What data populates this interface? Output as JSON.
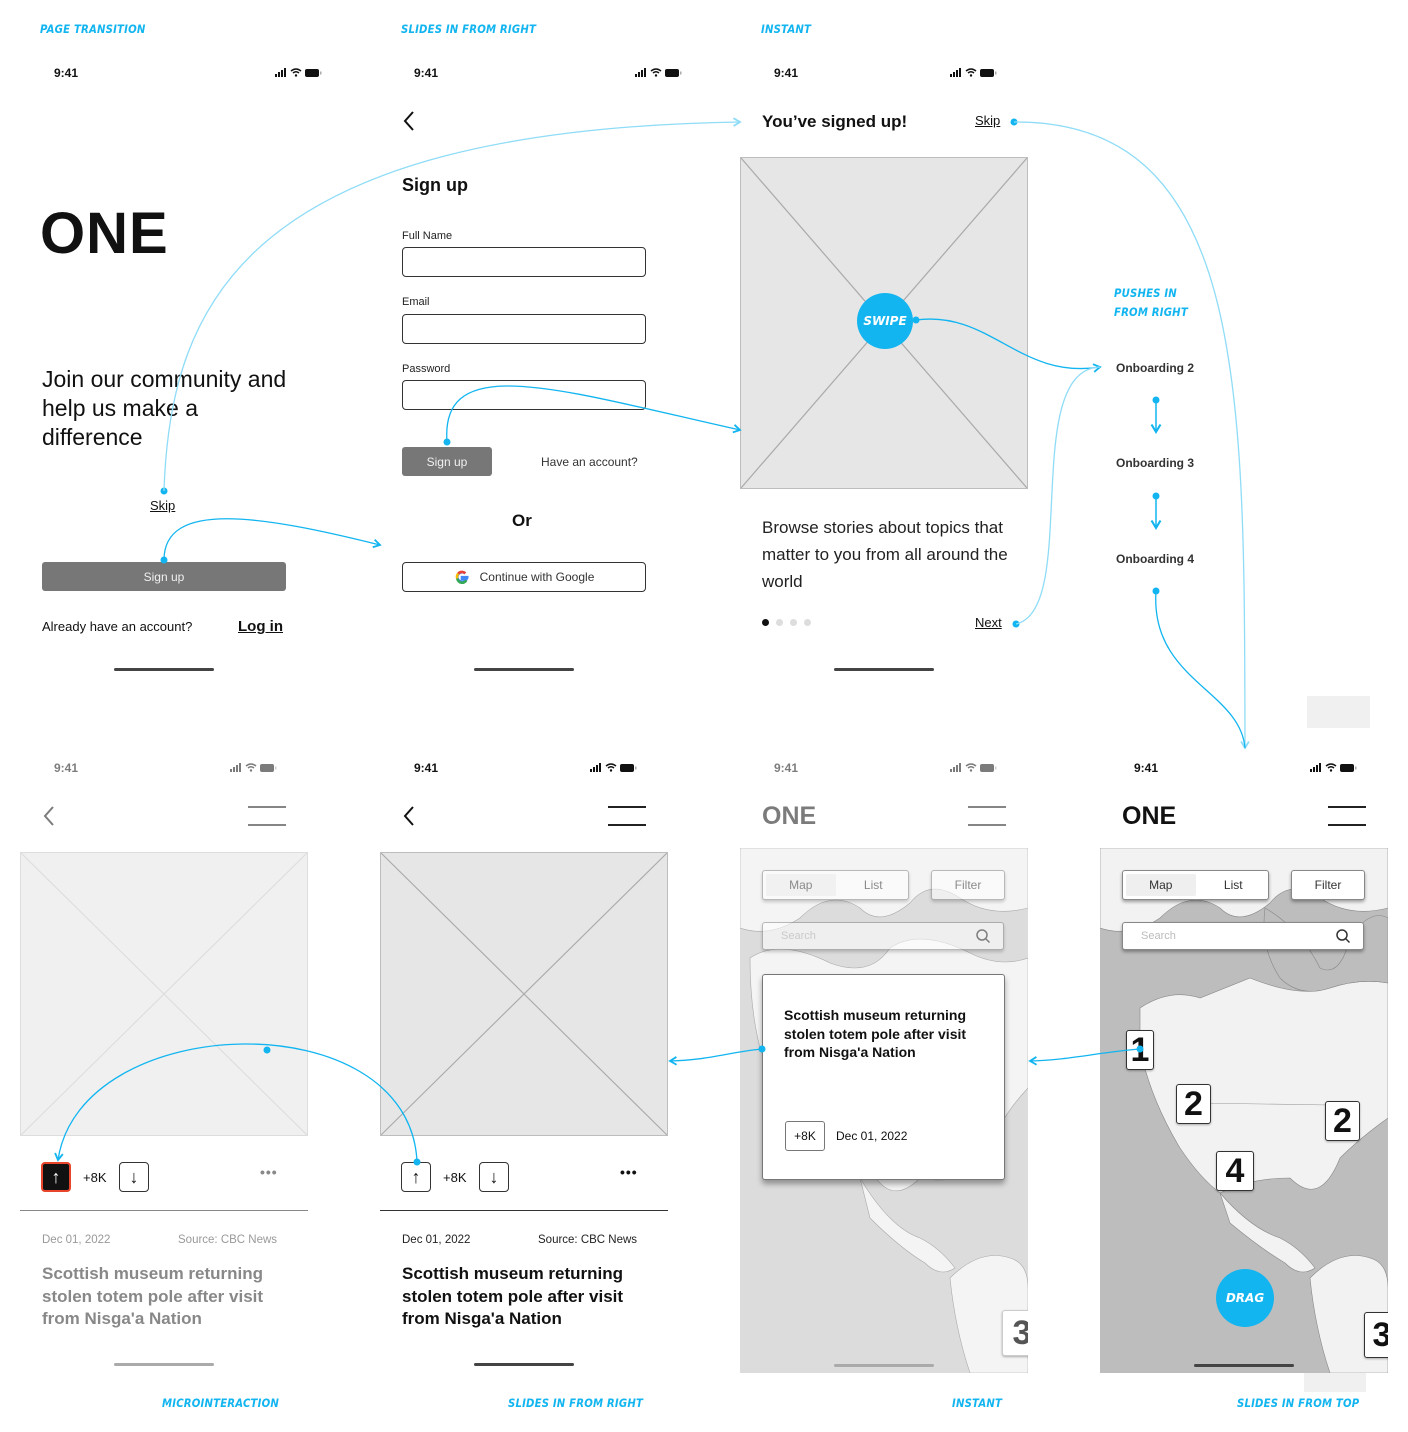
{
  "transition_labels": {
    "screen1": "PAGE TRANSITION",
    "screen2": "SLIDES IN FROM RIGHT",
    "screen3": "INSTANT",
    "onboarding": "PUSHES IN FROM RIGHT",
    "onboarding_line1": "PUSHES IN",
    "onboarding_line2": "FROM RIGHT",
    "screen5": "MICROINTERACTION",
    "screen6": "SLIDES IN FROM RIGHT",
    "screen7": "INSTANT",
    "screen8": "SLIDES IN FROM TOP"
  },
  "status_bar": {
    "time": "9:41"
  },
  "colors": {
    "accent": "#12b5f0",
    "upvote_active_border": "#e8452c",
    "button_gray": "#777777",
    "map_water": "#bdbdbd",
    "map_land": "#f2f2f2"
  },
  "welcome": {
    "logo": "ONE",
    "tagline": "Join our community and help us make a difference",
    "skip": "Skip",
    "signup_button": "Sign up",
    "have_account": "Already have an account?",
    "login": "Log in"
  },
  "signup": {
    "title": "Sign up",
    "fields": [
      {
        "label": "Full Name",
        "value": ""
      },
      {
        "label": "Email",
        "value": ""
      },
      {
        "label": "Password",
        "value": ""
      }
    ],
    "submit": "Sign up",
    "have_account": "Have an account?",
    "or": "Or",
    "google": "Continue with Google"
  },
  "onboarding1": {
    "title": "You’ve signed up!",
    "skip": "Skip",
    "gesture": "SWIPE",
    "body": "Browse stories about topics that matter to you from all around the world",
    "page_dots": {
      "total": 4,
      "active": 1
    },
    "next": "Next"
  },
  "onboarding_flow": [
    "Onboarding 2",
    "Onboarding 3",
    "Onboarding 4"
  ],
  "article": {
    "vote_count": "+8K",
    "date": "Dec 01, 2022",
    "source": "Source: CBC News",
    "headline": "Scottish museum returning stolen totem pole after visit from Nisga'a Nation",
    "more": "•••"
  },
  "map_screen": {
    "logo": "ONE",
    "tabs": [
      "Map",
      "List"
    ],
    "active_tab": "Map",
    "filter": "Filter",
    "search_placeholder": "Search",
    "gesture": "DRAG",
    "pins": [
      "1",
      "2",
      "2",
      "4",
      "3"
    ],
    "card": {
      "headline": "Scottish museum returning stolen totem pole after visit from Nisga'a Nation",
      "votes": "+8K",
      "date": "Dec 01, 2022"
    }
  }
}
